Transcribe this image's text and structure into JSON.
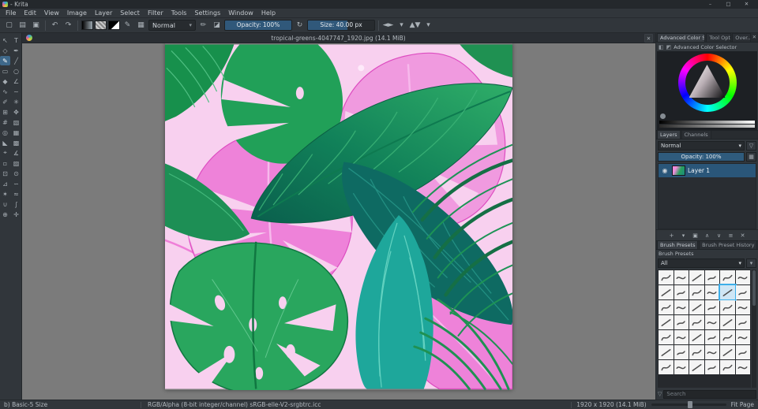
{
  "window": {
    "title": "- Krita",
    "minimize": "–",
    "maximize": "□",
    "close": "✕"
  },
  "menu": {
    "items": [
      "File",
      "Edit",
      "View",
      "Image",
      "Layer",
      "Select",
      "Filter",
      "Tools",
      "Settings",
      "Window",
      "Help"
    ]
  },
  "toolbar": {
    "items": [
      {
        "type": "icon",
        "name": "new-document-icon",
        "glyph": "▢"
      },
      {
        "type": "icon",
        "name": "open-image-icon",
        "glyph": "▤"
      },
      {
        "type": "icon",
        "name": "save-icon",
        "glyph": "▣"
      },
      {
        "type": "sep"
      },
      {
        "type": "icon",
        "name": "undo-icon",
        "glyph": "↶"
      },
      {
        "type": "icon",
        "name": "redo-icon",
        "glyph": "↷"
      },
      {
        "type": "sep"
      },
      {
        "type": "swatch",
        "name": "gradient-chooser",
        "css": "linear-gradient(90deg,#000,#9aa5ad)"
      },
      {
        "type": "swatch",
        "name": "pattern-chooser",
        "css": "repeating-linear-gradient(45deg,#888 0 2px,#ccc 2px 4px)"
      },
      {
        "type": "swatch",
        "name": "foreground-background-colors",
        "css": "linear-gradient(135deg,#000 0 55%,#fff 55%)"
      },
      {
        "type": "icon",
        "name": "choose-brush-preset-icon",
        "glyph": "✎"
      },
      {
        "type": "icon",
        "name": "fill-pattern-icon",
        "glyph": "▦"
      },
      {
        "type": "dropdown",
        "name": "blending-mode-select",
        "label": "Normal",
        "caret": "▾"
      },
      {
        "type": "icon",
        "name": "paint-mode-icon",
        "glyph": "✏"
      },
      {
        "type": "icon",
        "name": "erase-mode-icon",
        "glyph": "◪"
      },
      {
        "type": "slider",
        "name": "opacity-slider",
        "label": "Opacity:  100%",
        "fill": 1
      },
      {
        "type": "icon",
        "name": "reload-preset-icon",
        "glyph": "↻"
      },
      {
        "type": "slider",
        "name": "size-slider",
        "label": "Size:  40.00 px",
        "fill": 0.6
      },
      {
        "type": "sep"
      },
      {
        "type": "icon",
        "name": "mirror-horizontal-icon",
        "glyph": "◄►"
      },
      {
        "type": "icon",
        "name": "mirror-horizontal-caret-icon",
        "glyph": "▾"
      },
      {
        "type": "icon",
        "name": "mirror-vertical-icon",
        "glyph": "▲▼"
      },
      {
        "type": "icon",
        "name": "toolbar-overflow-icon",
        "glyph": "▾"
      }
    ]
  },
  "toolbox": {
    "tools": [
      {
        "name": "select-shapes",
        "glyph": "↖"
      },
      {
        "name": "text",
        "glyph": "T"
      },
      {
        "name": "edit-shapes",
        "glyph": "◇"
      },
      {
        "name": "calligraphy",
        "glyph": "✒"
      },
      {
        "name": "freehand-brush",
        "glyph": "✎",
        "active": true
      },
      {
        "name": "line",
        "glyph": "╱"
      },
      {
        "name": "rectangle",
        "glyph": "▭"
      },
      {
        "name": "ellipse",
        "glyph": "○"
      },
      {
        "name": "polygon",
        "glyph": "◆"
      },
      {
        "name": "polyline",
        "glyph": "∠"
      },
      {
        "name": "bezier-curve",
        "glyph": "∿"
      },
      {
        "name": "freehand-path",
        "glyph": "~"
      },
      {
        "name": "dynamic-brush",
        "glyph": "✐"
      },
      {
        "name": "multibrush",
        "glyph": "✳"
      },
      {
        "name": "transform",
        "glyph": "⊞"
      },
      {
        "name": "move",
        "glyph": "✥"
      },
      {
        "name": "crop",
        "glyph": "#"
      },
      {
        "name": "gradient",
        "glyph": "▧"
      },
      {
        "name": "color-sampler",
        "glyph": "◎"
      },
      {
        "name": "pattern-edit",
        "glyph": "▦"
      },
      {
        "name": "fill",
        "glyph": "◣"
      },
      {
        "name": "enclose-fill",
        "glyph": "▩"
      },
      {
        "name": "assistants",
        "glyph": "⌖"
      },
      {
        "name": "measure",
        "glyph": "∡"
      },
      {
        "name": "reference-images",
        "glyph": "▫"
      },
      {
        "name": "smart-patch",
        "glyph": "▨"
      },
      {
        "name": "rectangular-select",
        "glyph": "⊡"
      },
      {
        "name": "elliptical-select",
        "glyph": "⊙"
      },
      {
        "name": "polygonal-select",
        "glyph": "⊿"
      },
      {
        "name": "freehand-select",
        "glyph": "∽"
      },
      {
        "name": "contiguous-select",
        "glyph": "✶"
      },
      {
        "name": "similar-color-select",
        "glyph": "≈"
      },
      {
        "name": "magnetic-select",
        "glyph": "∪"
      },
      {
        "name": "bezier-select",
        "glyph": "∫"
      },
      {
        "name": "zoom",
        "glyph": "⊕"
      },
      {
        "name": "pan",
        "glyph": "✛"
      }
    ]
  },
  "document": {
    "title": "tropical-greens-4047747_1920.jpg (14.1 MiB)",
    "close_glyph": "✕"
  },
  "canvas_palette": {
    "background_pink": "#f8d0ef",
    "leaf_magenta": "#ee82d9",
    "leaf_green": "#29a65e",
    "leaf_dark_green": "#117a43",
    "leaf_teal": "#0e6a62",
    "leaf_cyan": "#1ea79b"
  },
  "right_panel": {
    "docker_tabs": [
      {
        "label": "Advanced Color Sele...",
        "active": true
      },
      {
        "label": "Tool Opt...",
        "active": false
      },
      {
        "label": "Over...",
        "active": false
      }
    ],
    "docker_close_glyph": "✕",
    "advanced_color_selector": {
      "title": "Advanced Color Selector",
      "settings_glyph": "◧",
      "shape_glyph": "◩"
    },
    "layers": {
      "tabs": [
        {
          "label": "Layers",
          "active": true
        },
        {
          "label": "Channels",
          "active": false
        }
      ],
      "blend_mode": "Normal",
      "blend_caret": "▾",
      "filter_glyph": "▽",
      "checker_glyph": "▦",
      "opacity_label": "Opacity:  100%",
      "rows": [
        {
          "name": "Layer 1",
          "eye_glyph": "◉"
        }
      ],
      "actions": [
        {
          "name": "add-layer",
          "glyph": "+"
        },
        {
          "name": "add-layer-options",
          "glyph": "▾"
        },
        {
          "name": "duplicate-layer",
          "glyph": "▣"
        },
        {
          "name": "move-layer-up",
          "glyph": "∧"
        },
        {
          "name": "move-layer-down",
          "glyph": "∨"
        },
        {
          "name": "layer-properties",
          "glyph": "≡"
        },
        {
          "name": "delete-layer",
          "glyph": "✕"
        }
      ]
    },
    "brush": {
      "tabs": [
        {
          "label": "Brush Presets",
          "active": true
        },
        {
          "label": "Brush Preset History",
          "active": false
        }
      ],
      "title": "Brush Presets",
      "filter_value": "All",
      "filter_caret": "▾",
      "tag_glyph": "▾",
      "search_glyph": "▽",
      "search_placeholder": "Search",
      "count": 42,
      "selected_index": 10
    }
  },
  "status_bar": {
    "brush_name": "b) Basic-5 Size",
    "color_profile": "RGB/Alpha (8-bit integer/channel)  sRGB-elle-V2-srgbtrc.icc",
    "image_size": "1920 x 1920 (14.1 MiB)",
    "zoom_mode": "Fit Page"
  }
}
